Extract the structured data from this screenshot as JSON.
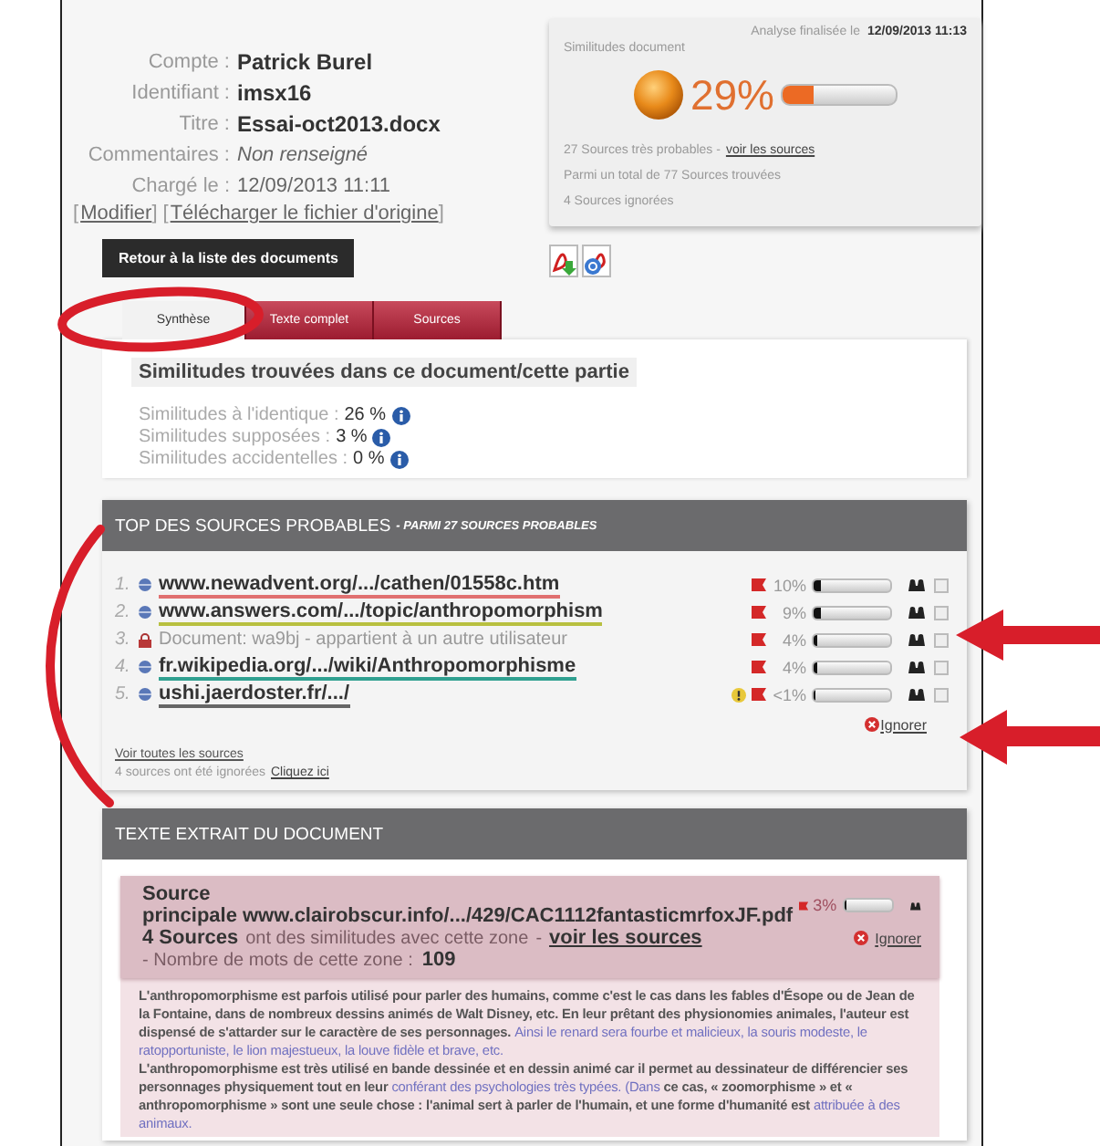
{
  "account": {
    "fields": [
      {
        "label": "Compte :",
        "value": "Patrick Burel",
        "kind": "bold"
      },
      {
        "label": "Identifiant :",
        "value": "imsx16",
        "kind": "bold"
      },
      {
        "label": "Titre :",
        "value": "Essai-oct2013.docx",
        "kind": "bold"
      },
      {
        "label": "Commentaires :",
        "value": "Non renseigné",
        "kind": "italic"
      },
      {
        "label": "Chargé le :",
        "value": "12/09/2013 11:11",
        "kind": "plain"
      }
    ],
    "links": [
      {
        "open": "[",
        "label": "Modifier",
        "close": "]"
      },
      {
        "open": "[",
        "label": "Télécharger le fichier d'origine",
        "close": "]"
      }
    ],
    "back_button": "Retour à la liste des documents"
  },
  "analysis": {
    "finished_label": "Analyse finalisée le",
    "finished_date": "12/09/2013 11:13",
    "title": "Similitudes document",
    "percent": "29%",
    "level": 0.29,
    "probable": "27 Sources très probables -",
    "probable_link": "voir les sources",
    "total": "Parmi un total de 77 Sources trouvées",
    "ignored": "4 Sources ignorées"
  },
  "tabs": [
    {
      "label": "Synthèse",
      "selected": true
    },
    {
      "label": "Texte complet",
      "selected": false
    },
    {
      "label": "Sources",
      "selected": false
    }
  ],
  "summary": {
    "heading": "Similitudes trouvées dans ce document/cette partie",
    "stats": [
      {
        "label": "Similitudes à l'identique :",
        "value": "26 %"
      },
      {
        "label": "Similitudes supposées :",
        "value": "3 %"
      },
      {
        "label": "Similitudes accidentelles :",
        "value": "0 %"
      }
    ]
  },
  "top_sources": {
    "title": "TOP DES SOURCES PROBABLES",
    "subtitle": "- PARMI 27 SOURCES PROBABLES",
    "rows": [
      {
        "number": "1.",
        "kind": "link",
        "text": "www.newadvent.org/.../cathen/01558c.htm",
        "color": "#e07070",
        "warning": false,
        "percent": "10%",
        "level": 0.1,
        "checked": false
      },
      {
        "number": "2.",
        "kind": "link",
        "text": "www.answers.com/.../topic/anthropomorphism",
        "color": "#b8c040",
        "warning": false,
        "percent": "9%",
        "level": 0.09,
        "checked": false
      },
      {
        "number": "3.",
        "kind": "document",
        "text": "Document: wa9bj - appartient à un autre utilisateur",
        "warning": false,
        "percent": "4%",
        "level": 0.04,
        "checked": false
      },
      {
        "number": "4.",
        "kind": "link",
        "text": "fr.wikipedia.org/.../wiki/Anthropomorphisme",
        "color": "#30a090",
        "warning": false,
        "percent": "4%",
        "level": 0.04,
        "checked": false
      },
      {
        "number": "5.",
        "kind": "link",
        "text": "ushi.jaerdoster.fr/.../",
        "color": "#666666",
        "warning": true,
        "percent": "<1%",
        "level": 0.01,
        "checked": false
      }
    ],
    "ignore": "Ignorer",
    "all_link": "Voir toutes les sources",
    "ignored_note": "4 sources ont été ignorées",
    "ignored_link": "Cliquez ici"
  },
  "extract": {
    "title": "TEXTE EXTRAIT DU DOCUMENT",
    "source_label": "Source principale",
    "source_url": "www.clairobscur.info/.../429/CAC1112fantasticmrfoxJF.pdf",
    "percent": "3%",
    "level": 0.03,
    "count": "4 Sources",
    "count_text": "ont des similitudes avec cette zone",
    "dash": "-",
    "link": "voir les sources",
    "ignore": "Ignorer",
    "words_label": "- Nombre de mots de cette zone :",
    "words": "109",
    "paragraphs": [
      {
        "segments": [
          {
            "kind": "plain",
            "text": "L'anthropomorphisme est parfois utilisé pour parler des humains, comme c'est le cas dans les fables d'Ésope ou de Jean de la Fontaine, dans de nombreux dessins animés de Walt Disney, etc. En leur prêtant des physionomies animales, l'auteur est dispensé de s'attarder sur le caractère de ses personnages. "
          },
          {
            "kind": "source",
            "text": "Ainsi le renard sera fourbe et malicieux, la souris modeste, le ratopportuniste, le lion majestueux, la louve fidèle et brave, etc."
          }
        ]
      },
      {
        "segments": [
          {
            "kind": "plain",
            "text": "L'anthropomorphisme est très utilisé en bande dessinée et en dessin animé car il permet au dessinateur de différencier ses personnages physiquement tout en leur "
          },
          {
            "kind": "source",
            "text": "conférant des psychologies très typées. (Dans"
          },
          {
            "kind": "plain",
            "text": " ce cas, « zoomorphisme » et « anthropomorphisme » sont une seule chose : l'animal sert à parler de l'humain, et une forme d'humanité est "
          },
          {
            "kind": "source",
            "text": "attribuée à des animaux."
          }
        ]
      }
    ]
  }
}
